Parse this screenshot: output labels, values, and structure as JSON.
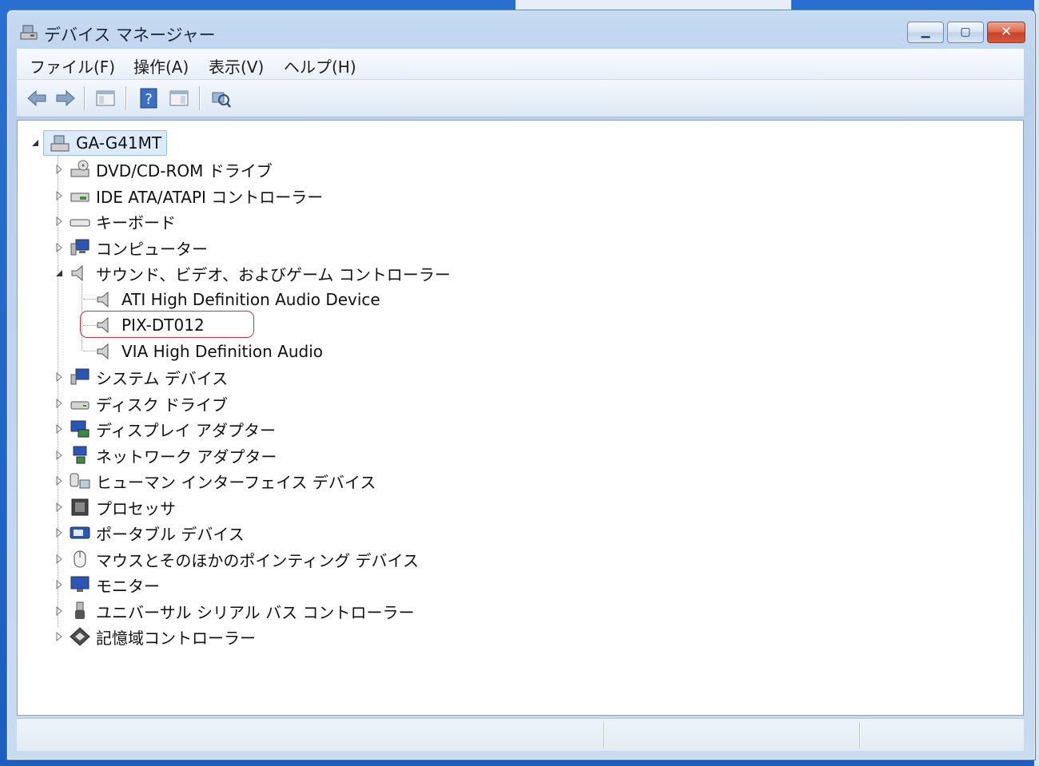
{
  "window": {
    "title": "デバイス マネージャー"
  },
  "menu": [
    "ファイル(F)",
    "操作(A)",
    "表示(V)",
    "ヘルプ(H)"
  ],
  "tree": {
    "root": "GA-G41MT",
    "categories": [
      {
        "label": "DVD/CD-ROM ドライブ",
        "icon": "dvd-drive-icon"
      },
      {
        "label": "IDE ATA/ATAPI コントローラー",
        "icon": "ide-controller-icon"
      },
      {
        "label": "キーボード",
        "icon": "keyboard-icon"
      },
      {
        "label": "コンピューター",
        "icon": "computer-icon"
      },
      {
        "label": "サウンド、ビデオ、およびゲーム コントローラー",
        "icon": "speaker-icon",
        "expanded": true,
        "children": [
          "ATI High Definition Audio Device",
          "PIX-DT012",
          "VIA High Definition Audio"
        ]
      },
      {
        "label": "システム デバイス",
        "icon": "system-device-icon"
      },
      {
        "label": "ディスク ドライブ",
        "icon": "disk-drive-icon"
      },
      {
        "label": "ディスプレイ アダプター",
        "icon": "display-adapter-icon"
      },
      {
        "label": "ネットワーク アダプター",
        "icon": "network-adapter-icon"
      },
      {
        "label": "ヒューマン インターフェイス デバイス",
        "icon": "hid-icon"
      },
      {
        "label": "プロセッサ",
        "icon": "processor-icon"
      },
      {
        "label": "ポータブル デバイス",
        "icon": "portable-device-icon"
      },
      {
        "label": "マウスとそのほかのポインティング デバイス",
        "icon": "mouse-icon"
      },
      {
        "label": "モニター",
        "icon": "monitor-icon"
      },
      {
        "label": "ユニバーサル シリアル バス コントローラー",
        "icon": "usb-icon"
      },
      {
        "label": "記憶域コントローラー",
        "icon": "storage-controller-icon"
      }
    ]
  },
  "colors": {
    "highlight": "#c0384a",
    "accent": "#2a6fd0"
  }
}
